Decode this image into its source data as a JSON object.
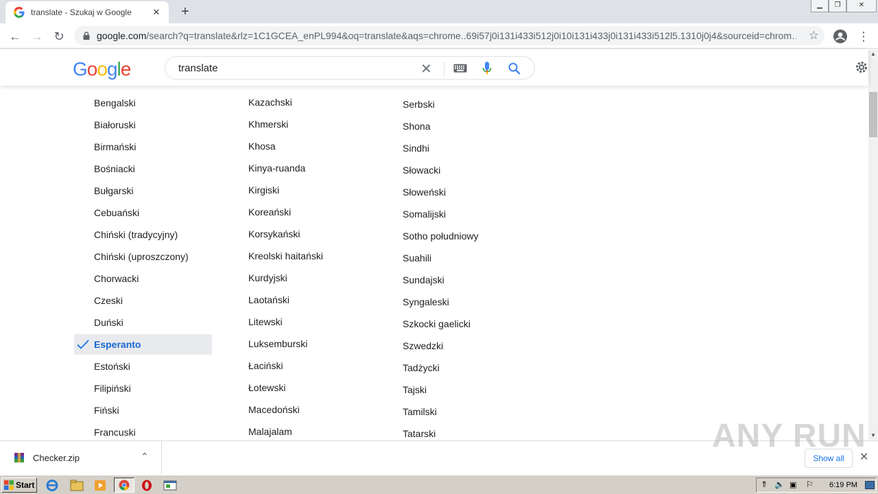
{
  "browser": {
    "tab_title": "translate - Szukaj w Google",
    "url_host": "google.com",
    "url_rest": "/search?q=translate&rlz=1C1GCEA_enPL994&oq=translate&aqs=chrome..69i57j0i131i433i512j0i10i131i433j0i131i433i512l5.1310j0j4&sourceid=chrom…"
  },
  "search": {
    "logo": "Google",
    "query": "translate"
  },
  "languages": {
    "col1": [
      "Bengalski",
      "Białoruski",
      "Birmański",
      "Bośniacki",
      "Bułgarski",
      "Cebuański",
      "Chiński (tradycyjny)",
      "Chiński (uproszczony)",
      "Chorwacki",
      "Czeski",
      "Duński",
      "Esperanto",
      "Estoński",
      "Filipiński",
      "Fiński",
      "Francuski"
    ],
    "col2": [
      "Kazachski",
      "Khmerski",
      "Khosa",
      "Kinya-ruanda",
      "Kirgiski",
      "Koreański",
      "Korsykański",
      "Kreolski haitański",
      "Kurdyjski",
      "Laotański",
      "Litewski",
      "Luksemburski",
      "Łaciński",
      "Łotewski",
      "Macedoński",
      "Malajalam"
    ],
    "col3": [
      "Serbski",
      "Shona",
      "Sindhi",
      "Słowacki",
      "Słoweński",
      "Somalijski",
      "Sotho południowy",
      "Suahili",
      "Sundajski",
      "Syngaleski",
      "Szkocki gaelicki",
      "Szwedzki",
      "Tadżycki",
      "Tajski",
      "Tamilski",
      "Tatarski"
    ],
    "selected": "Esperanto"
  },
  "download": {
    "file_name": "Checker.zip",
    "show_all": "Show all"
  },
  "watermark": "ANY RUN",
  "taskbar": {
    "start_label": "Start",
    "time": "6:19 PM"
  },
  "colors": {
    "accent": "#1a73e8",
    "selected_text": "#1967d2"
  }
}
